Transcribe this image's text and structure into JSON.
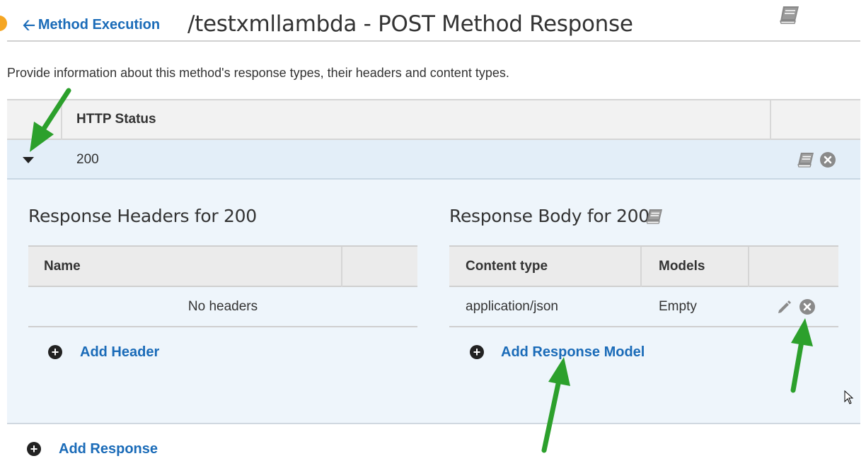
{
  "header": {
    "back_label": "Method Execution",
    "title": "/testxmllambda - POST Method Response"
  },
  "description": "Provide information about this method's response types, their headers and content types.",
  "status_table": {
    "column_header": "HTTP Status",
    "rows": [
      {
        "status": "200"
      }
    ]
  },
  "response_headers": {
    "title": "Response Headers for 200",
    "columns": [
      "Name"
    ],
    "empty_text": "No headers",
    "add_label": "Add Header"
  },
  "response_body": {
    "title": "Response Body for 200",
    "columns": [
      "Content type",
      "Models"
    ],
    "rows": [
      {
        "content_type": "application/json",
        "model": "Empty"
      }
    ],
    "add_label": "Add Response Model"
  },
  "add_response_label": "Add Response",
  "colors": {
    "link": "#1a6bb8",
    "row_selected_bg": "#e3eef8",
    "panel_bg": "#eef5fb",
    "annotation_arrow": "#2ca02c"
  },
  "icons": [
    "arrow-left-icon",
    "book-icon",
    "caret-down-icon",
    "remove-icon",
    "pencil-icon",
    "plus-circle-icon",
    "mouse-cursor-icon",
    "annotation-arrow"
  ]
}
